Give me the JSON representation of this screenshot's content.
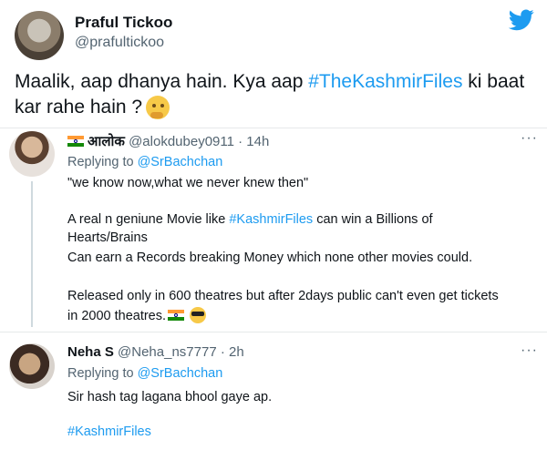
{
  "main_tweet": {
    "name": "Praful Tickoo",
    "handle": "@prafultickoo",
    "text_before": "Maalik, aap dhanya hain. Kya aap ",
    "hashtag": "#TheKashmirFiles",
    "text_after": " ki baat kar rahe hain ?",
    "emoji": "thinking-face-icon"
  },
  "replies": [
    {
      "name": "आलोक",
      "handle_time": "@alokdubey0911 · 14h",
      "replying_prefix": "Replying to ",
      "replying_to": "@SrBachchan",
      "lines": {
        "l1": "\"we know now,what we never knew then\"",
        "l2_before": "A real n geniune Movie like ",
        "l2_tag": "#KashmirFiles",
        "l2_after": " can win a Billions of",
        "l3": "Hearts/Brains",
        "l4": "Can earn a Records breaking Money which none other movies could.",
        "l5": "Released only in 600 theatres but after 2days public can't even get tickets",
        "l6": "in 2000 theatres."
      }
    },
    {
      "name": "Neha S",
      "handle_time": "@Neha_ns7777 · 2h",
      "replying_prefix": "Replying to ",
      "replying_to": "@SrBachchan",
      "lines": {
        "l1": "Sir hash tag lagana bhool gaye ap.",
        "l2": "#KashmirFiles"
      }
    }
  ],
  "more_label": "···",
  "colors": {
    "accent": "#1d9bf0",
    "muted": "#536471",
    "separator": "#e6e9ea"
  }
}
